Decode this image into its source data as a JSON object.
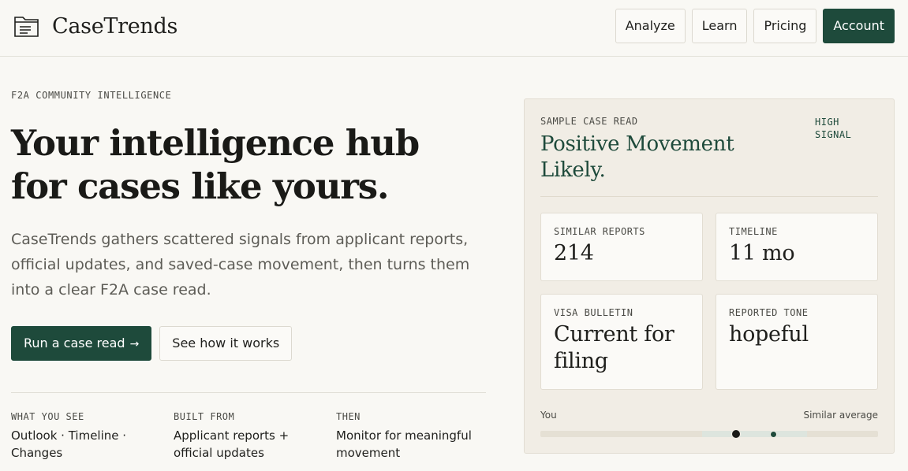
{
  "brand": {
    "name": "CaseTrends",
    "icon": "folder-icon"
  },
  "nav": {
    "analyze": "Analyze",
    "learn": "Learn",
    "pricing": "Pricing",
    "account": "Account"
  },
  "hero": {
    "eyebrow": "F2A COMMUNITY INTELLIGENCE",
    "title_line1": "Your intelligence hub",
    "title_line2": "for cases like yours.",
    "subtitle": "CaseTrends gathers scattered signals from applicant reports, official updates, and saved-case movement, then turns them into a clear F2A case read.",
    "cta_primary": "Run a case read",
    "cta_primary_icon": "arrow-right-icon",
    "cta_secondary": "See how it works"
  },
  "facts": [
    {
      "label": "WHAT YOU SEE",
      "value": "Outlook · Timeline · Changes"
    },
    {
      "label": "BUILT FROM",
      "value": "Applicant reports + official updates"
    },
    {
      "label": "THEN",
      "value": "Monitor for meaningful movement"
    }
  ],
  "card": {
    "eyebrow": "SAMPLE CASE READ",
    "signal": "HIGH SIGNAL",
    "title": "Positive Movement Likely.",
    "stats": [
      {
        "label": "SIMILAR REPORTS",
        "value": "214"
      },
      {
        "label": "TIMELINE",
        "value": "11 mo"
      },
      {
        "label": "VISA BULLETIN",
        "value": "Current for filing"
      },
      {
        "label": "REPORTED TONE",
        "value": "hopeful"
      }
    ],
    "compare": {
      "you_label": "You",
      "avg_label": "Similar average",
      "you_position": 0.58,
      "avg_position": 0.69,
      "range_start": 0.48,
      "range_end": 0.79
    },
    "colors": {
      "accent": "#1e4a3b",
      "card_bg": "#f1ede5",
      "page_bg": "#f9f8f4"
    }
  }
}
